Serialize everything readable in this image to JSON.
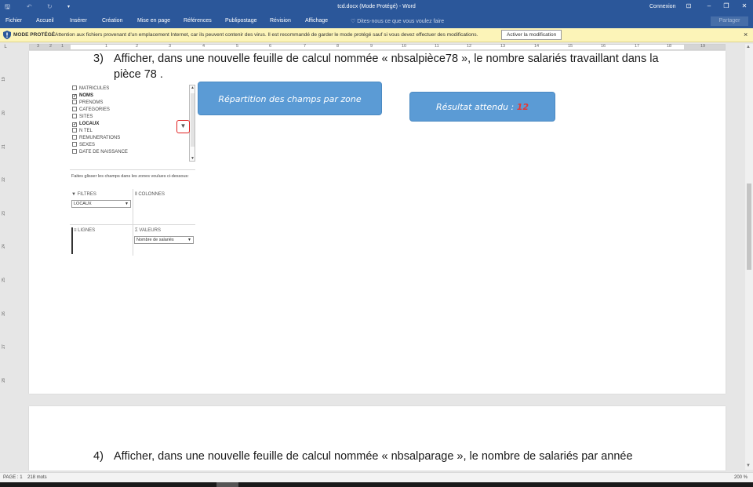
{
  "titlebar": {
    "save_icon": "save-icon",
    "undo_icon": "undo-icon",
    "redo_icon": "redo-icon",
    "title": "tcd.docx (Mode Protégé) - Word",
    "connexion": "Connexion",
    "controls": [
      "⊡",
      "–",
      "❐",
      "✕"
    ]
  },
  "ribbon": {
    "tabs": [
      "Fichier",
      "Accueil",
      "Insérer",
      "Création",
      "Mise en page",
      "Références",
      "Publipostage",
      "Révision",
      "Affichage"
    ],
    "tell_me": "Dites-nous ce que vous voulez faire",
    "share": "Partager"
  },
  "protected_bar": {
    "label": "MODE PROTÉGÉ",
    "message": "Attention aux fichiers provenant d'un emplacement Internet, car ils peuvent contenir des virus. Il est recommandé de garder le mode protégé sauf si vous devez effectuer des modifications.",
    "button": "Activer la modification",
    "close": "×"
  },
  "ruler": {
    "corner": "L",
    "numbers": [
      "3",
      "2",
      "1",
      "",
      "1",
      "2",
      "3",
      "4",
      "5",
      "6",
      "7",
      "8",
      "9",
      "10",
      "11",
      "12",
      "13",
      "14",
      "15",
      "16",
      "17",
      "18",
      "19"
    ],
    "vnumbers": [
      "19",
      "20",
      "21",
      "22",
      "23",
      "24",
      "25",
      "26",
      "27",
      "28"
    ]
  },
  "page1": {
    "question_number": "3)",
    "question_line1": "Afficher, dans une nouvelle feuille de calcul nommée « nbsalpièce78 », le nombre salariés travaillant dans la",
    "question_line2": "pièce 78 ."
  },
  "field_list": {
    "fields": [
      {
        "name": "MATRICULES",
        "checked": false
      },
      {
        "name": "NOMS",
        "checked": true
      },
      {
        "name": "PRENOMS",
        "checked": false
      },
      {
        "name": "CATEGORIES",
        "checked": false
      },
      {
        "name": "SITES",
        "checked": false
      },
      {
        "name": "LOCAUX",
        "checked": true
      },
      {
        "name": "N TEL",
        "checked": false
      },
      {
        "name": "REMUNERATIONS",
        "checked": false
      },
      {
        "name": "SEXES",
        "checked": false
      },
      {
        "name": "DATE DE NAISSANCE",
        "checked": false
      }
    ],
    "drag_hint": "Faites glisser les champs dans les zones voulues ci-dessous:",
    "zones": {
      "filters": "FILTRES",
      "columns": "COLONNES",
      "rows": "LIGNES",
      "values": "VALEURS",
      "filter_item": "LOCAUX",
      "values_item": "Nombre de salariés"
    }
  },
  "callouts": {
    "repartition": "Répartition des champs par zone",
    "resultat_label": "Résultat attendu : ",
    "resultat_value": "12"
  },
  "page2": {
    "question_number": "4)",
    "question_line1": "Afficher, dans une nouvelle feuille de calcul nommée « nbsalparage », le nombre de salariés par année"
  },
  "status": {
    "page": "PAGE : 1",
    "words": "218 mots",
    "zoom": "200 %"
  },
  "colors": {
    "word_blue": "#2b579a",
    "callout_blue": "#5b9bd5",
    "protected_yellow": "#fcf4b8",
    "highlight_red": "#e53935"
  }
}
